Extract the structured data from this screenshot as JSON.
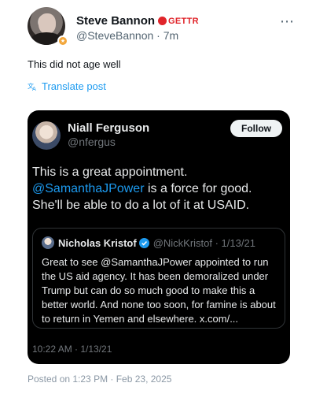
{
  "post": {
    "author": {
      "display_name": "Steve Bannon",
      "platform_tag": "GETTR",
      "handle": "@SteveBannon",
      "age": "7m",
      "badge_icon": "gold-badge-icon"
    },
    "more_icon": "⋯",
    "text": "This did not age well",
    "translate_label": "Translate post",
    "posted_on": "Posted on 1:23 PM · Feb 23, 2025"
  },
  "quoted": {
    "author": {
      "display_name": "Niall Ferguson",
      "handle": "@nfergus"
    },
    "follow_label": "Follow",
    "text_before": "This is a great appointment. ",
    "mention": "@SamanthaJPower",
    "text_after": " is a force for good. She'll be able to do a lot of it at USAID.",
    "timestamp": "10:22 AM · 1/13/21",
    "inner": {
      "display_name": "Nicholas Kristof",
      "handle_date": "@NickKristof · 1/13/21",
      "text": "Great to see @SamanthaJPower appointed to run the US aid agency. It has been demoralized under Trump but can do so much good to make this a better world. And none too soon, for famine is about to return in Yemen and elsewhere. x.com/..."
    }
  },
  "colors": {
    "accent": "#1d9bf0",
    "gettr_red": "#e0242a",
    "card_bg": "#000000",
    "muted": "#71767b"
  }
}
